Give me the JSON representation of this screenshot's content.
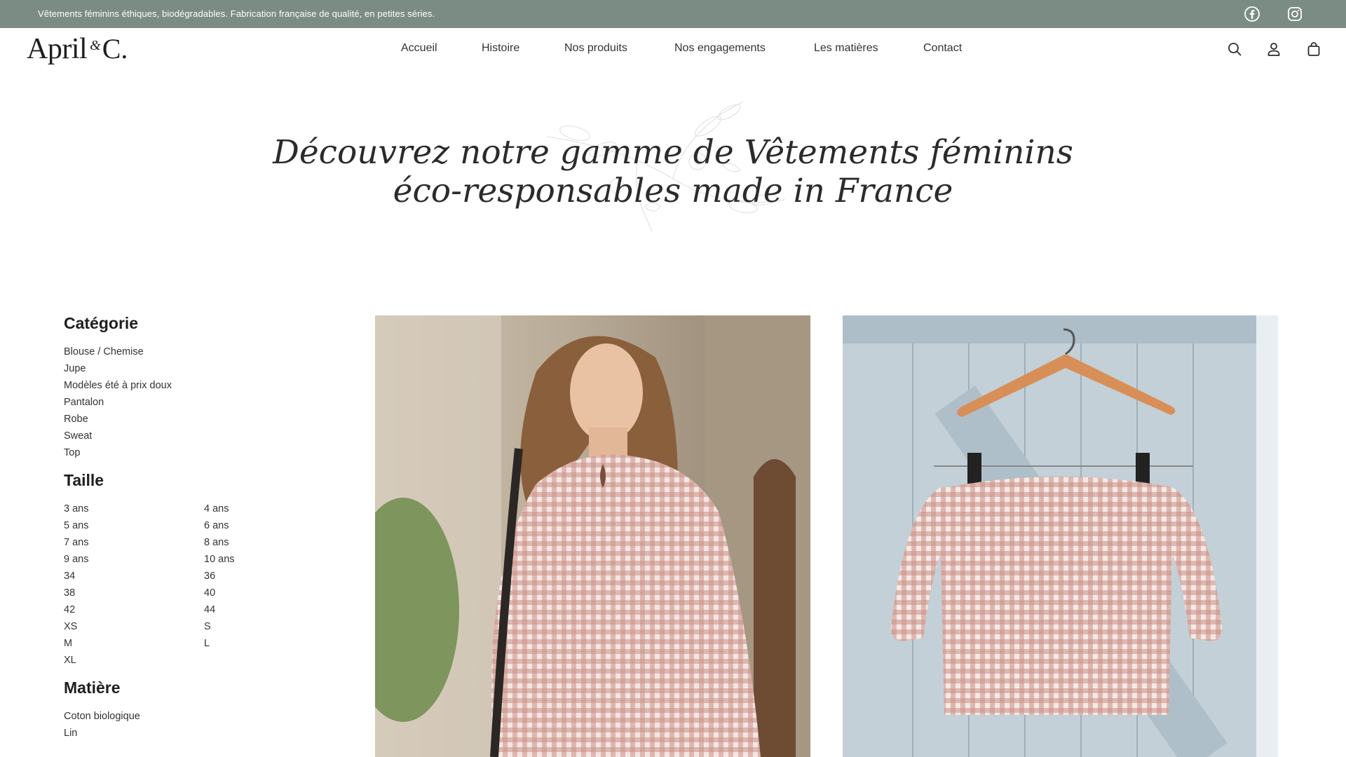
{
  "announcement": {
    "text": "Vêtements féminins éthiques, biodégradables. Fabrication française de qualité, en petites séries.",
    "social_icons": [
      "facebook-icon",
      "instagram-icon"
    ]
  },
  "brand": {
    "logo_word": "April",
    "logo_amp": "&",
    "logo_c": "C."
  },
  "nav": {
    "items": [
      "Accueil",
      "Histoire",
      "Nos produits",
      "Nos engagements",
      "Les matières",
      "Contact"
    ]
  },
  "header_icons": [
    "search-icon",
    "account-icon",
    "cart-icon"
  ],
  "hero": {
    "line1": "Découvrez notre gamme de Vêtements féminins",
    "line2": "éco-responsables made in France"
  },
  "filters": {
    "category": {
      "title": "Catégorie",
      "items": [
        "Blouse / Chemise",
        "Jupe",
        "Modèles été à prix doux",
        "Pantalon",
        "Robe",
        "Sweat",
        "Top"
      ]
    },
    "size": {
      "title": "Taille",
      "items": [
        "3 ans",
        "4 ans",
        "5 ans",
        "6 ans",
        "7 ans",
        "8 ans",
        "9 ans",
        "10 ans",
        "34",
        "36",
        "38",
        "40",
        "42",
        "44",
        "XS",
        "S",
        "M",
        "L",
        "XL"
      ]
    },
    "material": {
      "title": "Matière",
      "items": [
        "Coton biologique",
        "Lin"
      ]
    }
  },
  "colors": {
    "topbar": "#7b8c84",
    "text": "#2b2b2b",
    "gingham": "#c98f86",
    "shutter": "#b9c8d0"
  }
}
